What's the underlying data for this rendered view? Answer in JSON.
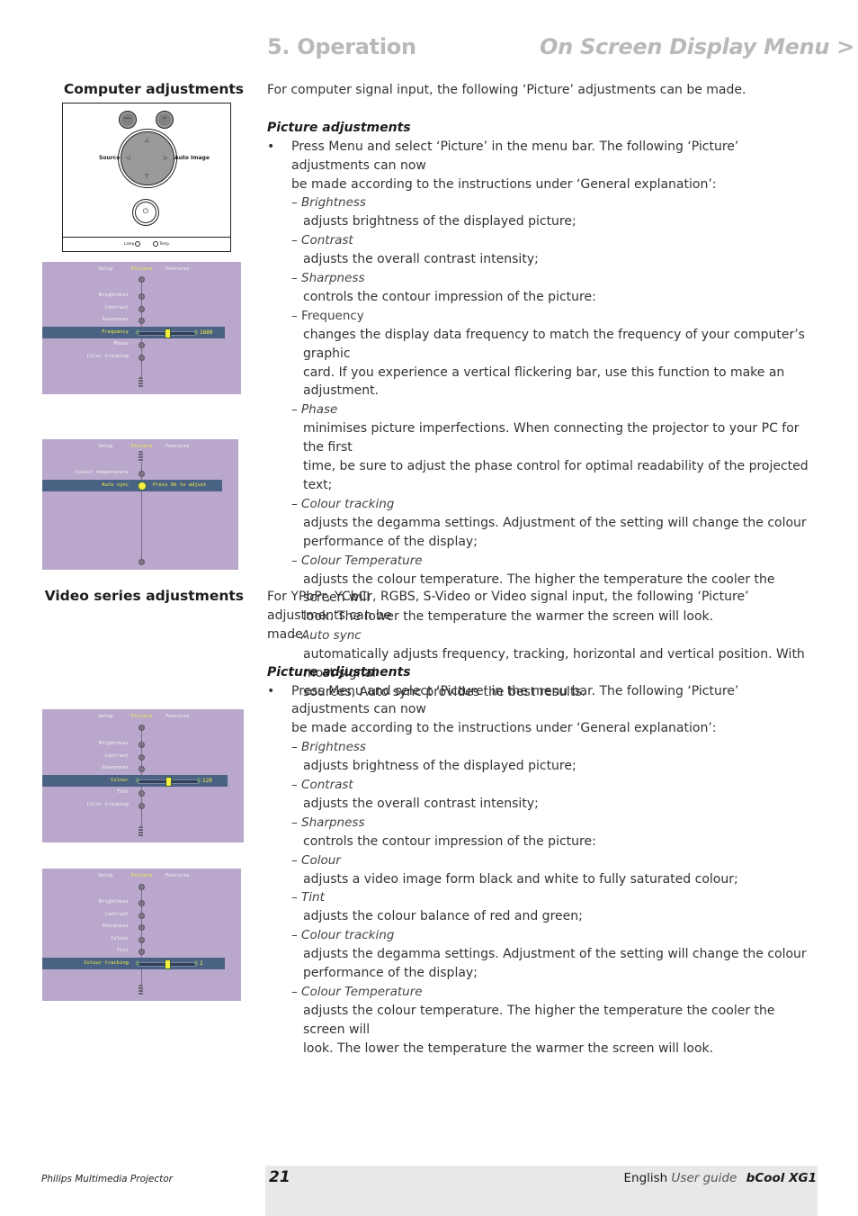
{
  "header": {
    "chapter": "5. Operation",
    "section": "On Screen Display Menu  >"
  },
  "computer": {
    "title": "Computer adjustments",
    "intro": "For computer signal input, the following ‘Picture’ adjustments can be made.",
    "subheading": "Picture adjustments",
    "bullet": "•",
    "bullet_text_1": "Press Menu and select ‘Picture’ in the menu bar. The following ‘Picture’ adjustments can now",
    "bullet_text_2": "be made according to the instructions under ‘General explanation’:",
    "items": [
      {
        "term": "– Brightness",
        "desc": [
          "adjusts brightness of the displayed picture;"
        ]
      },
      {
        "term": "– Contrast",
        "desc": [
          "adjusts the overall contrast intensity;"
        ]
      },
      {
        "term": "– Sharpness",
        "desc": [
          "controls the contour impression of the picture:"
        ]
      },
      {
        "term": "– Frequency",
        "desc": [
          "changes the display data frequency to match the frequency of your computer’s graphic",
          "card. If you experience a vertical flickering bar, use this function to make an adjustment."
        ]
      },
      {
        "term": "– Phase",
        "desc": [
          "minimises picture imperfections. When connecting the projector to your PC for the first",
          "time, be sure to adjust the phase control for optimal readability of the projected text;"
        ]
      },
      {
        "term": "– Colour tracking",
        "desc": [
          "adjusts the degamma settings. Adjustment of the setting will change the colour",
          "performance of the display;"
        ]
      },
      {
        "term": "– Colour Temperature",
        "desc": [
          "adjusts the colour temperature. The higher the temperature the cooler the screen will",
          "look. The lower the temperature the warmer the screen will look."
        ]
      },
      {
        "term": "– Auto sync",
        "desc": [
          "automatically adjusts frequency, tracking, horizontal and vertical position. With most signal",
          "sources, Auto sync provides the best results."
        ]
      }
    ]
  },
  "video": {
    "title": "Video series adjustments",
    "intro_1": "For YPbPr, YCbCr, RGBS, S-Video or Video signal input, the following ‘Picture’  adjustments can be",
    "intro_2": "made.",
    "subheading": "Picture adjustments",
    "bullet": "•",
    "bullet_text_1": "Press Menu and select ‘Picture’ in the menu bar. The following ‘Picture’ adjustments can now",
    "bullet_text_2": "be made according to the instructions under ‘General explanation’:",
    "items": [
      {
        "term": "– Brightness",
        "desc": [
          "adjusts brightness of the displayed picture;"
        ]
      },
      {
        "term": "– Contrast",
        "desc": [
          "adjusts the overall contrast intensity;"
        ]
      },
      {
        "term": "– Sharpness",
        "desc": [
          "controls the contour impression of the picture:"
        ]
      },
      {
        "term": "– Colour",
        "desc": [
          "adjusts a video image form black and white to fully saturated colour;"
        ]
      },
      {
        "term": "– Tint",
        "desc": [
          "adjusts the colour balance of red and green;"
        ]
      },
      {
        "term": "– Colour tracking",
        "desc": [
          "adjusts the degamma settings. Adjustment of the setting will change the colour",
          "performance of the display;"
        ]
      },
      {
        "term": "– Colour Temperature",
        "desc": [
          "adjusts the colour temperature. The higher the temperature the cooler the screen will",
          "look. The lower the temperature the warmer the screen will look."
        ]
      }
    ]
  },
  "remote": {
    "menu_label": "Menu",
    "ok_label": "OK",
    "source_label": "Source",
    "auto_image_label": "Auto Image",
    "up": "△",
    "down": "▽",
    "left": "◁",
    "right": "▷",
    "power": "⏻",
    "lamp_label": "Lamp",
    "temp_label": "Temp."
  },
  "osd": {
    "tabs": [
      "Setup",
      "Picture",
      "Features"
    ],
    "screen1": {
      "items": [
        "Brightness",
        "Contrast",
        "Sharpness",
        "Frequency",
        "Phase",
        "Color tracking"
      ],
      "selected": "Frequency",
      "value": "1680",
      "slider_fraction": 0.5
    },
    "screen2": {
      "items": [
        "Colour temperature",
        "Auto sync"
      ],
      "selected": "Auto sync",
      "hint": "Press Ok to adjust"
    },
    "screen3": {
      "items": [
        "Brightness",
        "Contrast",
        "Sharpness",
        "Colour",
        "Tint",
        "Color tracking"
      ],
      "selected": "Colour",
      "value": "128",
      "slider_fraction": 0.5
    },
    "screen4": {
      "items": [
        "Brightness",
        "Contrast",
        "Sharpness",
        "Colour",
        "Tint",
        "Colour tracking"
      ],
      "selected": "Colour tracking",
      "value": "2",
      "slider_fraction": 0.5
    }
  },
  "footer": {
    "product": "Philips Multimedia Projector",
    "page": "21",
    "language": "English",
    "guide": "User guide",
    "model": "bCool XG1"
  }
}
